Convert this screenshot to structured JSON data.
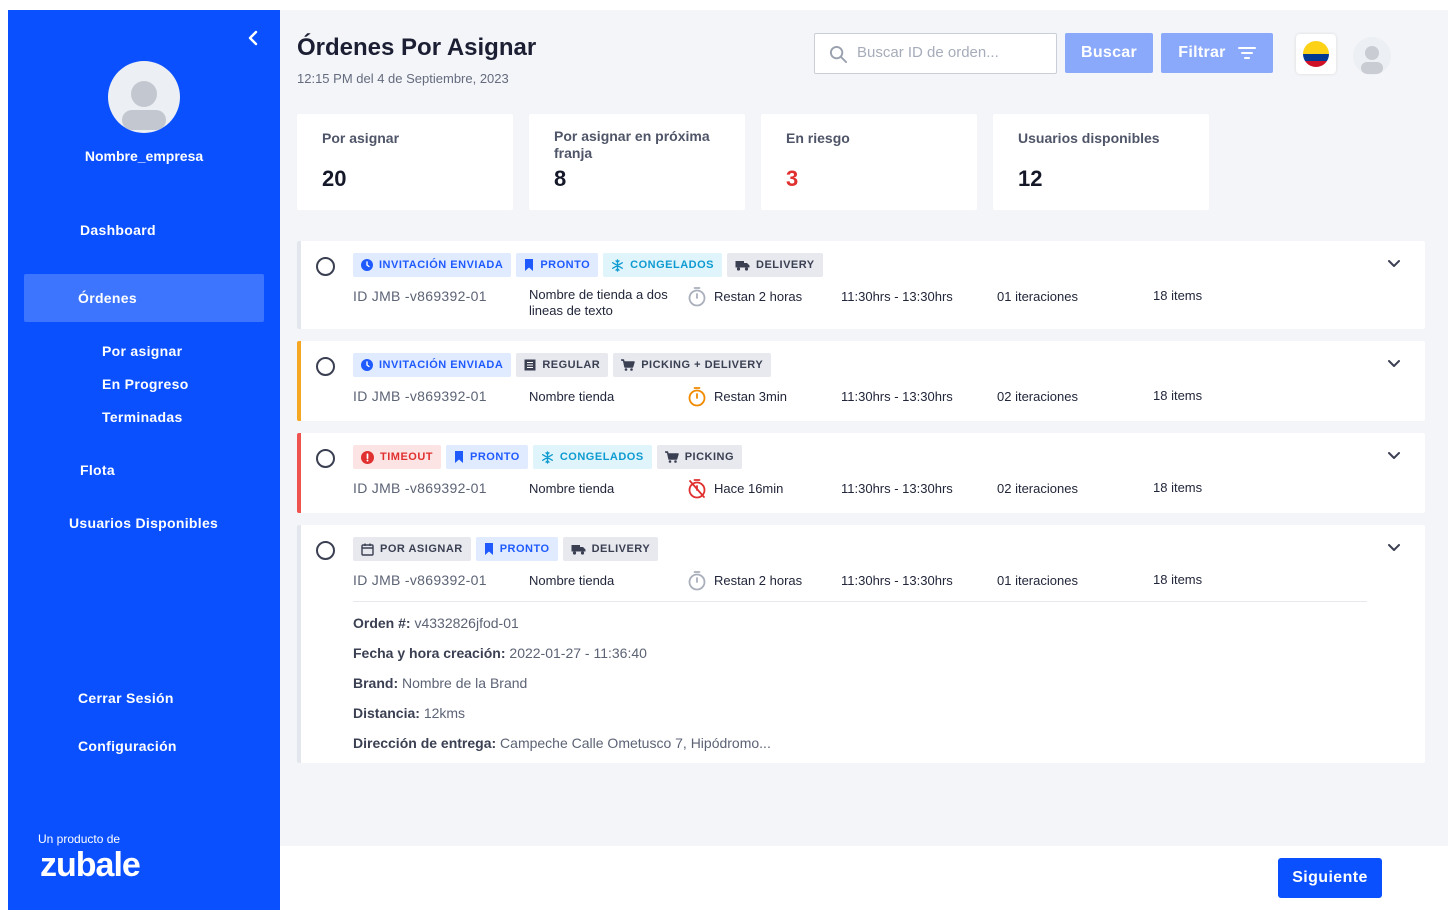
{
  "sidebar": {
    "company": "Nombre_empresa",
    "nav": {
      "dashboard": "Dashboard",
      "ordenes": "Órdenes",
      "por_asignar": "Por asignar",
      "en_progreso": "En Progreso",
      "terminadas": "Terminadas",
      "flota": "Flota",
      "usuarios": "Usuarios Disponibles",
      "cerrar": "Cerrar Sesión",
      "config": "Configuración"
    },
    "product_label": "Un producto de",
    "logo": "zubale"
  },
  "header": {
    "title": "Órdenes Por Asignar",
    "subtitle": "12:15 PM del 4 de Septiembre, 2023",
    "search_placeholder": "Buscar ID de orden...",
    "buscar": "Buscar",
    "filtrar": "Filtrar"
  },
  "stats": [
    {
      "label": "Por asignar",
      "value": "20",
      "color": "#151829"
    },
    {
      "label": "Por asignar en próxima franja",
      "value": "8",
      "color": "#151829"
    },
    {
      "label": "En riesgo",
      "value": "3",
      "color": "#e0302f"
    },
    {
      "label": "Usuarios disponibles",
      "value": "12",
      "color": "#151829"
    }
  ],
  "orders": [
    {
      "accent": "#e3e6ec",
      "tags": [
        {
          "text": "INVITACIÓN ENVIADA",
          "style": "blue",
          "icon": "clock-icon"
        },
        {
          "text": "PRONTO",
          "style": "blue",
          "icon": "bookmark-icon"
        },
        {
          "text": "CONGELADOS",
          "style": "sky",
          "icon": "snowflake-icon"
        },
        {
          "text": "DELIVERY",
          "style": "gray",
          "icon": "truck-icon"
        }
      ],
      "id": "ID JMB -v869392-01",
      "store": "Nombre de tienda a dos lineas de texto",
      "timer": "Restan 2 horas",
      "timer_state": "neutral",
      "window": "11:30hrs - 13:30hrs",
      "iterations": "01 iteraciones",
      "items": "18 items"
    },
    {
      "accent": "#f5a623",
      "tags": [
        {
          "text": "INVITACIÓN ENVIADA",
          "style": "blue",
          "icon": "clock-icon"
        },
        {
          "text": "REGULAR",
          "style": "gray",
          "icon": "list-icon"
        },
        {
          "text": "PICKING + DELIVERY",
          "style": "gray",
          "icon": "cart-icon"
        }
      ],
      "id": "ID JMB -v869392-01",
      "store": "Nombre tienda",
      "timer": "Restan 3min",
      "timer_state": "warning",
      "window": "11:30hrs - 13:30hrs",
      "iterations": "02 iteraciones",
      "items": "18 items"
    },
    {
      "accent": "#ef5350",
      "tags": [
        {
          "text": "TIMEOUT",
          "style": "red",
          "icon": "alert-icon"
        },
        {
          "text": "PRONTO",
          "style": "blue",
          "icon": "bookmark-icon"
        },
        {
          "text": "CONGELADOS",
          "style": "sky",
          "icon": "snowflake-icon"
        },
        {
          "text": "PICKING",
          "style": "gray",
          "icon": "cart-icon"
        }
      ],
      "id": "ID JMB -v869392-01",
      "store": "Nombre tienda",
      "timer": "Hace 16min",
      "timer_state": "danger",
      "window": "11:30hrs - 13:30hrs",
      "iterations": "02 iteraciones",
      "items": "18 items"
    },
    {
      "accent": "#e3e6ec",
      "tags": [
        {
          "text": "POR ASIGNAR",
          "style": "gray",
          "icon": "calendar-icon"
        },
        {
          "text": "PRONTO",
          "style": "blue",
          "icon": "bookmark-icon"
        },
        {
          "text": "DELIVERY",
          "style": "gray",
          "icon": "truck-icon"
        }
      ],
      "id": "ID JMB -v869392-01",
      "store": "Nombre tienda",
      "timer": "Restan 2 horas",
      "timer_state": "neutral",
      "window": "11:30hrs - 13:30hrs",
      "iterations": "01 iteraciones",
      "items": "18 items",
      "details": [
        {
          "label": "Orden #:",
          "value": "v4332826jfod-01"
        },
        {
          "label": "Fecha y hora creación:",
          "value": "2022-01-27 - 11:36:40"
        },
        {
          "label": "Brand:",
          "value": "Nombre de la Brand"
        },
        {
          "label": "Distancia:",
          "value": "12kms"
        },
        {
          "label": "Dirección de entrega:",
          "value": "Campeche Calle Ometusco 7, Hipódromo..."
        }
      ]
    }
  ],
  "footer": {
    "next": "Siguiente"
  },
  "colors": {
    "primary": "#0a50ff",
    "warning": "#f5a623",
    "danger": "#e0302f"
  }
}
